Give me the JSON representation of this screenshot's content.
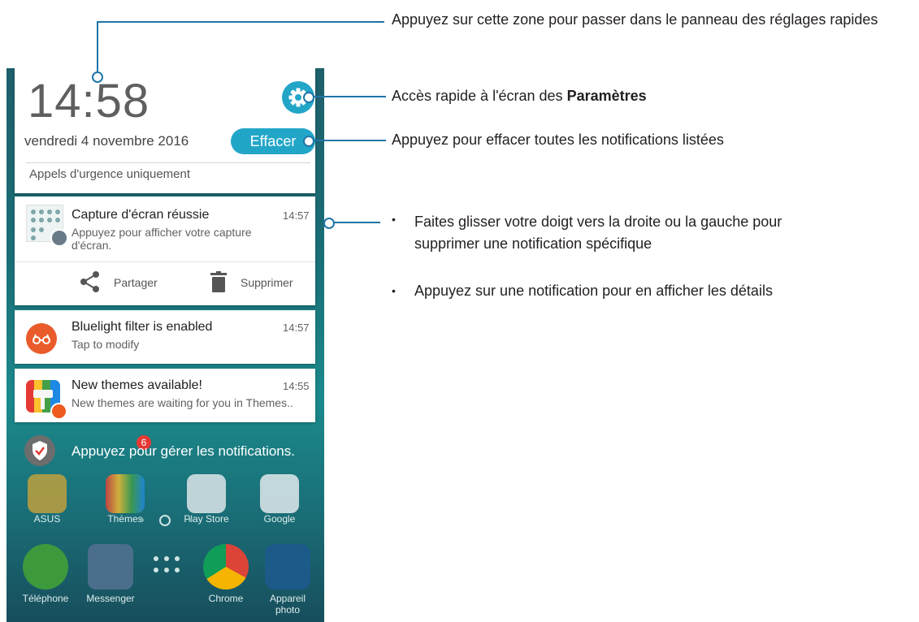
{
  "status": {
    "time": "14:58",
    "date": "vendredi 4 novembre 2016",
    "clear_label": "Effacer",
    "emergency": "Appels d'urgence uniquement"
  },
  "notifications": [
    {
      "title": "Capture d'écran réussie",
      "text": "Appuyez pour afficher votre capture d'écran.",
      "time": "14:57",
      "icon": "screenshot-icon",
      "actions": [
        "Partager",
        "Supprimer"
      ]
    },
    {
      "title": "Bluelight filter is enabled",
      "text": "Tap to modify",
      "time": "14:57",
      "icon": "bluelight-glasses-icon"
    },
    {
      "title": "New themes available!",
      "text": "New themes are waiting for you in Themes..",
      "time": "14:55",
      "icon": "themes-icon"
    }
  ],
  "manage_text": "Appuyez pour gérer les notifications.",
  "home": {
    "apps": [
      "ASUS",
      "Thèmes",
      "Play Store",
      "Google"
    ],
    "themes_badge": "6",
    "dock": [
      "Téléphone",
      "Messenger",
      "Chrome",
      "Appareil photo"
    ]
  },
  "callouts": {
    "quick_settings": "Appuyez sur cette zone pour passer dans le panneau des réglages rapides",
    "settings_prefix": "Accès rapide à l'écran des",
    "settings_bold": "Paramètres",
    "clear": "Appuyez pour effacer toutes les notifications listées",
    "bullets": [
      "Faites glisser votre doigt vers la droite ou la gauche pour supprimer une notification spécifique",
      "Appuyez sur une notification pour en afficher les détails"
    ]
  },
  "colors": {
    "accent": "#22a6c8",
    "callout_line": "#1f75a8",
    "bluelight": "#ea5b2b"
  }
}
